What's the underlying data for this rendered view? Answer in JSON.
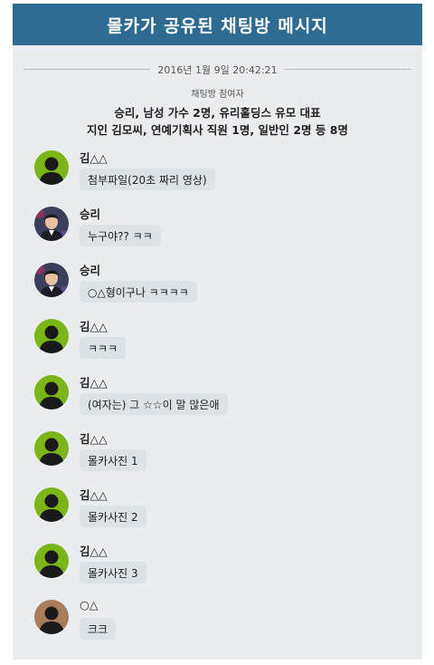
{
  "header": {
    "title": "몰카가 공유된 채팅방 메시지"
  },
  "date": "2016년 1월 9일 20:42:21",
  "participants": {
    "label": "채팅방 참여자",
    "line1": "승리, 남성 가수 2명, 유리홀딩스 유모 대표",
    "line2": "지인 김모씨, 연예기획사 직원 1명, 일반인 2명 등 8명"
  },
  "colors": {
    "header_bg": "#2e6b92",
    "panel_bg": "#e9edf0",
    "bubble_bg": "#dde2e6",
    "avatar_green": "#7cb518",
    "avatar_brown": "#a97c5a"
  },
  "messages": [
    {
      "sender": "김△△",
      "text": "첨부파일(20초 짜리 영상)",
      "avatar": "silhouette-green"
    },
    {
      "sender": "승리",
      "text": "누구야?? ㅋㅋ",
      "avatar": "photo"
    },
    {
      "sender": "승리",
      "text": "○△형이구나 ㅋㅋㅋㅋ",
      "avatar": "photo"
    },
    {
      "sender": "김△△",
      "text": "ㅋㅋㅋ",
      "avatar": "silhouette-green"
    },
    {
      "sender": "김△△",
      "text": "(여자는) 그 ☆☆이 말 많은애",
      "avatar": "silhouette-green"
    },
    {
      "sender": "김△△",
      "text": "몰카사진 1",
      "avatar": "silhouette-green"
    },
    {
      "sender": "김△△",
      "text": "몰카사진 2",
      "avatar": "silhouette-green"
    },
    {
      "sender": "김△△",
      "text": "몰카사진 3",
      "avatar": "silhouette-green"
    },
    {
      "sender": "○△",
      "text": "크크",
      "avatar": "silhouette-brown"
    }
  ]
}
